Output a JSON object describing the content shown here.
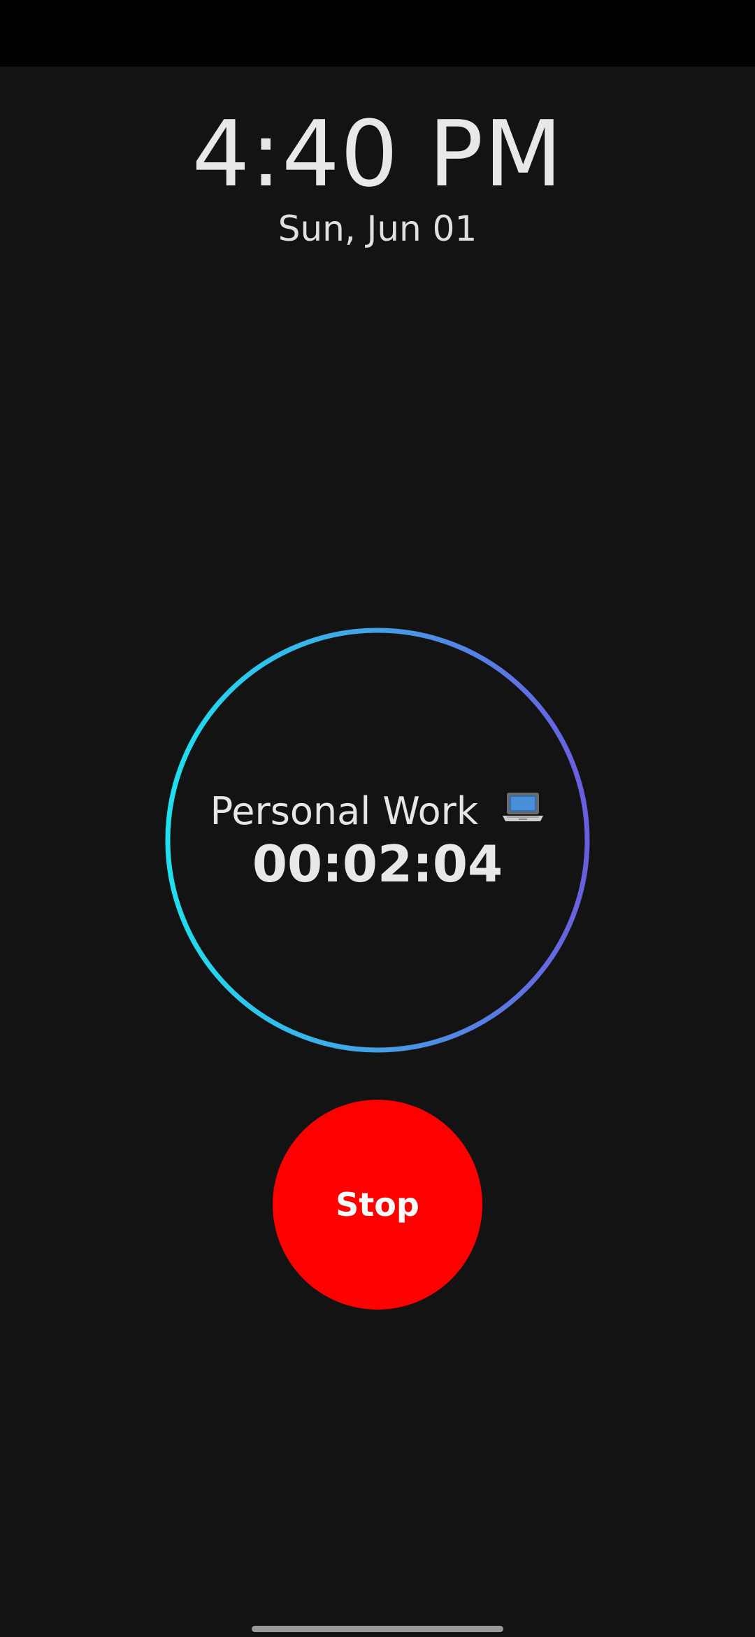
{
  "clock": {
    "time": "4:40 PM",
    "date": "Sun, Jun 01"
  },
  "timer": {
    "activity": "Personal Work",
    "activity_icon": "laptop-icon",
    "elapsed": "00:02:04",
    "ring_colors": [
      "#1ee0ee",
      "#6a5ee0"
    ]
  },
  "controls": {
    "stop_label": "Stop",
    "stop_color": "#ff0000"
  }
}
